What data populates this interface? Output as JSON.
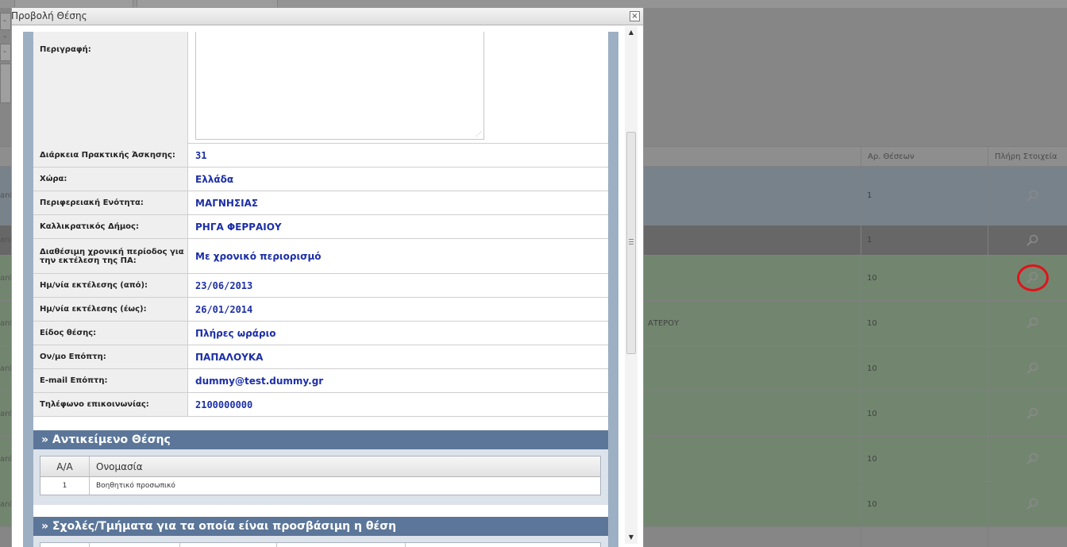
{
  "background": {
    "filters": [
      "---",
      "---"
    ],
    "columns": {
      "positions": "Αρ. Θέσεων",
      "details": "Πλήρη Στοιχεία"
    },
    "rows": [
      {
        "left": "ank",
        "mid": "",
        "count": "1",
        "color": "#a9bccd"
      },
      {
        "left": "ank",
        "mid": "",
        "count": "1",
        "color": "#8a8a8a"
      },
      {
        "left": "ank",
        "mid": "",
        "count": "10",
        "color": "#9fc39a"
      },
      {
        "left": "ank",
        "mid": "ΑΤΕΡΟΥ",
        "count": "10",
        "color": "#9fc39a"
      },
      {
        "left": "ank",
        "mid": "",
        "count": "10",
        "color": "#9fc39a"
      },
      {
        "left": "ank",
        "mid": "",
        "count": "10",
        "color": "#9fc39a"
      },
      {
        "left": "ank",
        "mid": "",
        "count": "10",
        "color": "#9fc39a"
      },
      {
        "left": "ank",
        "mid": "",
        "count": "10",
        "color": "#9fc39a"
      }
    ],
    "highlight_color": "#e0131b"
  },
  "dialog": {
    "title": "Προβολή Θέσης",
    "close_symbol": "×",
    "description_label": "Περιγραφή:",
    "fields": [
      {
        "label": "Διάρκεια Πρακτικής Άσκησης:",
        "value": "31"
      },
      {
        "label": "Χώρα:",
        "value": "Ελλάδα"
      },
      {
        "label": "Περιφερειακή Ενότητα:",
        "value": "ΜΑΓΝΗΣΙΑΣ"
      },
      {
        "label": "Καλλικρατικός Δήμος:",
        "value": "ΡΗΓΑ ΦΕΡΡΑΙΟΥ"
      },
      {
        "label": "Διαθέσιμη χρονική περίοδος για την εκτέλεση της ΠΑ:",
        "value": "Με χρονικό περιορισμό"
      },
      {
        "label": "Ημ/νία εκτέλεσης (από):",
        "value": "23/06/2013"
      },
      {
        "label": "Ημ/νία εκτέλεσης (έως):",
        "value": "26/01/2014"
      },
      {
        "label": "Είδος θέσης:",
        "value": "Πλήρες ωράριο"
      },
      {
        "label": "Ον/μο Επόπτη:",
        "value": "ΠΑΠΑΛΟΥΚΑ"
      },
      {
        "label": "E-mail Επόπτη:",
        "value": "dummy@test.dummy.gr"
      },
      {
        "label": "Τηλέφωνο επικοινωνίας:",
        "value": "2100000000"
      }
    ],
    "section_object": {
      "title": "» Αντικείμενο Θέσης",
      "columns": [
        "Α/Α",
        "Ονομασία"
      ],
      "rows": [
        {
          "aa": "1",
          "name": "Βοηθητικό προσωπικό"
        }
      ]
    },
    "section_schools": {
      "title": "» Σχολές/Τμήματα για τα οποία είναι προσβάσιμη η θέση"
    },
    "scrollbar": {
      "up": "▲",
      "down": "▼"
    }
  }
}
